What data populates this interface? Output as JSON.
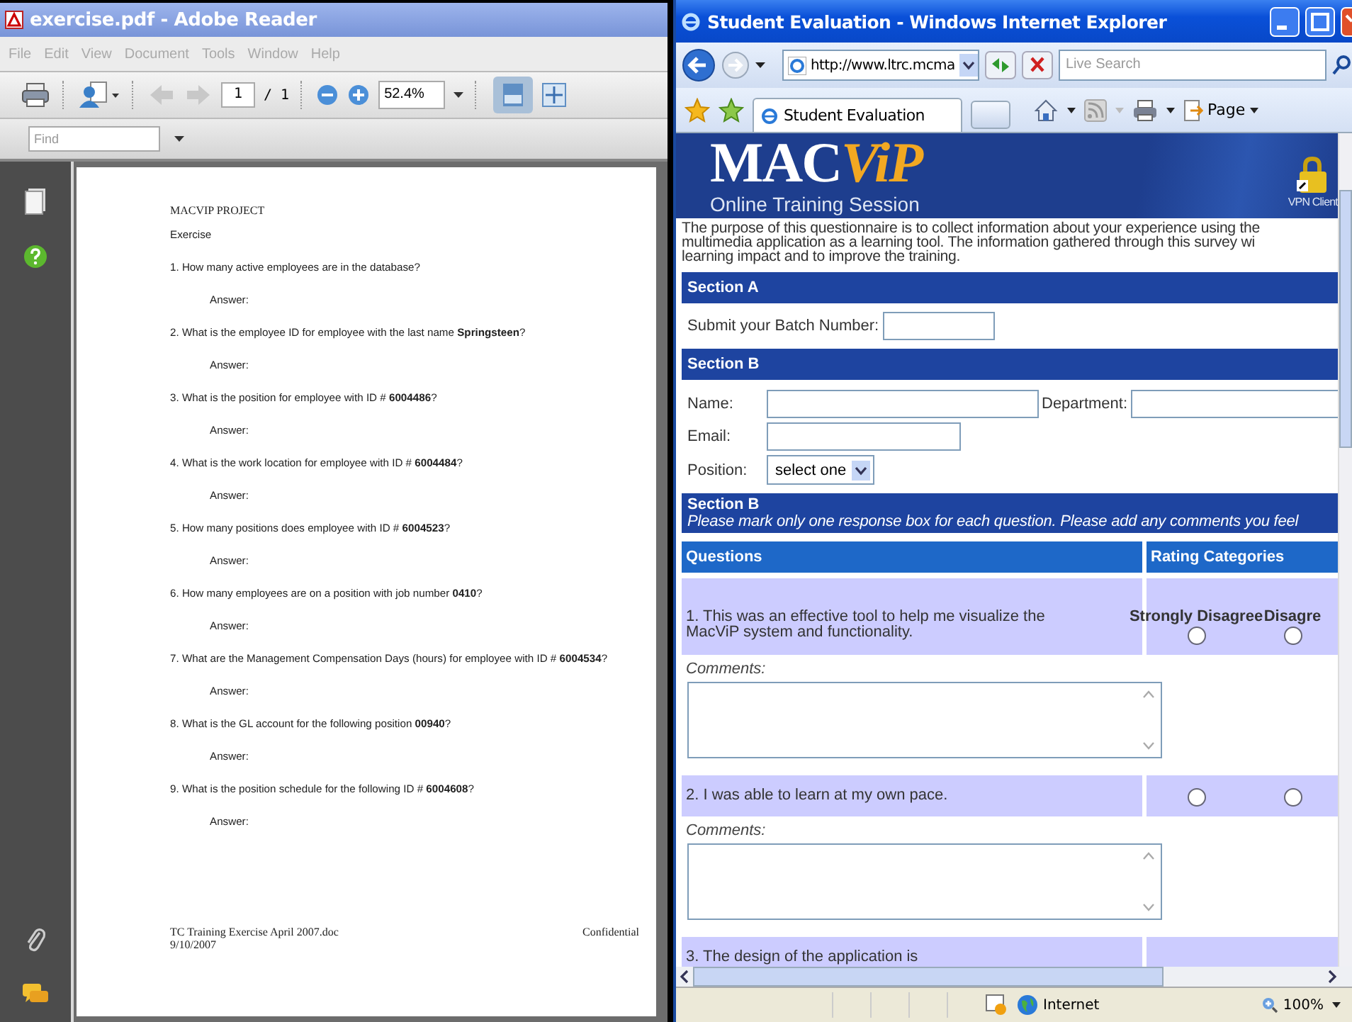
{
  "reader": {
    "title": "exercise.pdf - Adobe Reader",
    "menu": [
      "File",
      "Edit",
      "View",
      "Document",
      "Tools",
      "Window",
      "Help"
    ],
    "page_number": "1",
    "page_total": "/ 1",
    "zoom": "52.4%",
    "find_placeholder": "Find",
    "document": {
      "heading": "MACVIP PROJECT",
      "subtitle": "Exercise",
      "questions": [
        {
          "text": "1. How many active employees are in the database?",
          "answer": "Answer:"
        },
        {
          "text": "2. What is the employee ID for employee with the last name **Springsteen**?",
          "answer": "Answer:"
        },
        {
          "text": "3. What is the position for employee with ID # **6004486**?",
          "answer": "Answer:"
        },
        {
          "text": "4. What is the work location for employee with ID # **6004484**?",
          "answer": "Answer:"
        },
        {
          "text": "5. How many positions does employee with ID # **6004523**?",
          "answer": "Answer:"
        },
        {
          "text": "6. How many employees are on a position with job number **0410**?",
          "answer": "Answer:"
        },
        {
          "text": "7. What are the Management Compensation Days (hours) for employee with ID # **6004534**?",
          "answer": "Answer:"
        },
        {
          "text": "8. What is the GL account for the following position **00940**?",
          "answer": "Answer:"
        },
        {
          "text": "9. What is the position schedule for the following ID # **6004608**?",
          "answer": "Answer:"
        }
      ],
      "footer_left": "TC Training Exercise April 2007.doc",
      "footer_date": "9/10/2007",
      "footer_right": "Confidential"
    }
  },
  "browser": {
    "title": "Student Evaluation - Windows Internet Explorer",
    "address": "http://www.ltrc.mcma",
    "search_placeholder": "Live Search",
    "tab": "Student Evaluation",
    "page_menu": "Page",
    "site": {
      "logo_main": "MAC",
      "logo_accent": "ViP",
      "subtitle": "Online Training Session",
      "vpn": "VPN Client"
    },
    "intro": "The purpose of this questionnaire is to collect information about your experience using the\nmultimedia application as a learning tool. The information gathered through this survey wi\nlearning impact and to improve the training.",
    "section_a": "Section A",
    "batch_label": "Submit your Batch Number:",
    "section_b": "Section B",
    "name_label": "Name:",
    "department_label": "Department:",
    "email_label": "Email:",
    "position_label": "Position:",
    "position_value": "select one",
    "section_b2": "Section B",
    "instructions": "Please mark only one response box for each question. Please add any comments you feel",
    "questions_header": "Questions",
    "rating_header": "Rating Categories",
    "questions": [
      {
        "text": "1. This was an effective tool to help me visualize the MacViP system and functionality.",
        "comments_label": "Comments:",
        "rating_headings": [
          "Strongly Disagree",
          "Disagre"
        ],
        "radios": [
          {
            "selected": false
          },
          {
            "selected": false
          }
        ]
      },
      {
        "text": "2. I was able to learn at my own pace.",
        "comments_label": "Comments:",
        "radios": [
          {
            "selected": false
          },
          {
            "selected": false
          }
        ]
      },
      {
        "text": "3. The design of the application is"
      }
    ],
    "status_zone": "Internet",
    "status_zoom": "100%"
  }
}
